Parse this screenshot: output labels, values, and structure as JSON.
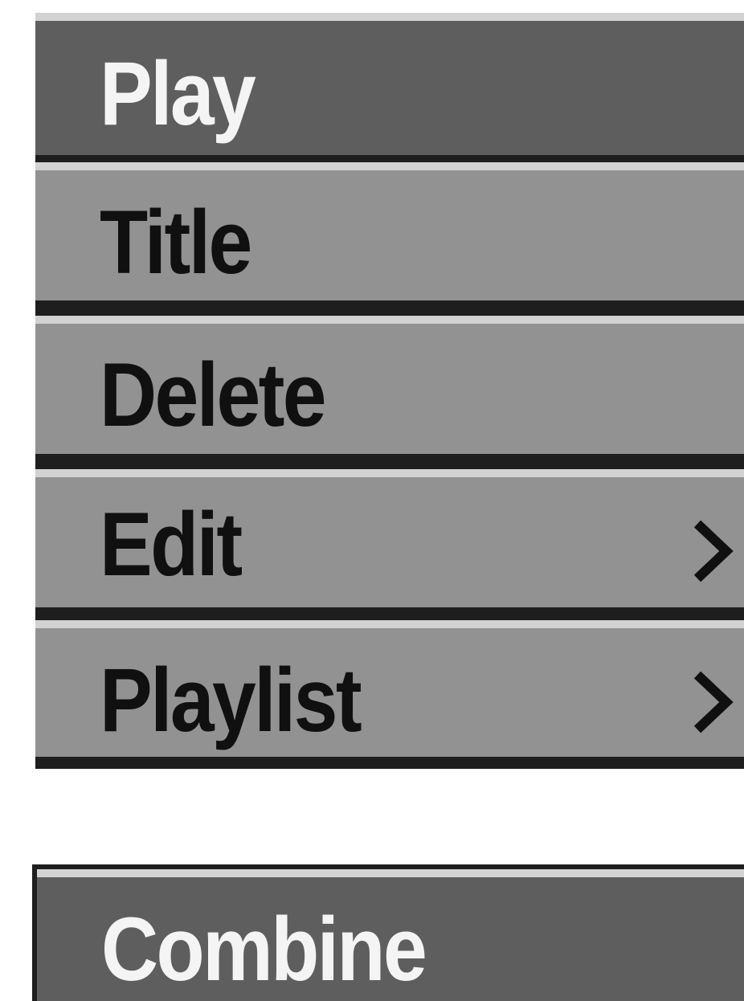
{
  "main_menu": {
    "items": [
      {
        "label": "Play",
        "selected": true,
        "has_submenu": false
      },
      {
        "label": "Title",
        "selected": false,
        "has_submenu": false
      },
      {
        "label": "Delete",
        "selected": false,
        "has_submenu": false
      },
      {
        "label": "Edit",
        "selected": false,
        "has_submenu": true,
        "arrow_icon": "chevron-right-icon"
      },
      {
        "label": "Playlist",
        "selected": false,
        "has_submenu": true,
        "arrow_icon": "chevron-right-icon"
      }
    ]
  },
  "sub_menu": {
    "items": [
      {
        "label": "Combine",
        "selected": true
      }
    ]
  },
  "colors": {
    "selected_background": "#5e5e5e",
    "item_background": "#929292",
    "highlight_edge": "#d2d2d2",
    "separator": "#1e1e1e",
    "selected_text": "#f4f4f4",
    "item_text": "#101010"
  }
}
